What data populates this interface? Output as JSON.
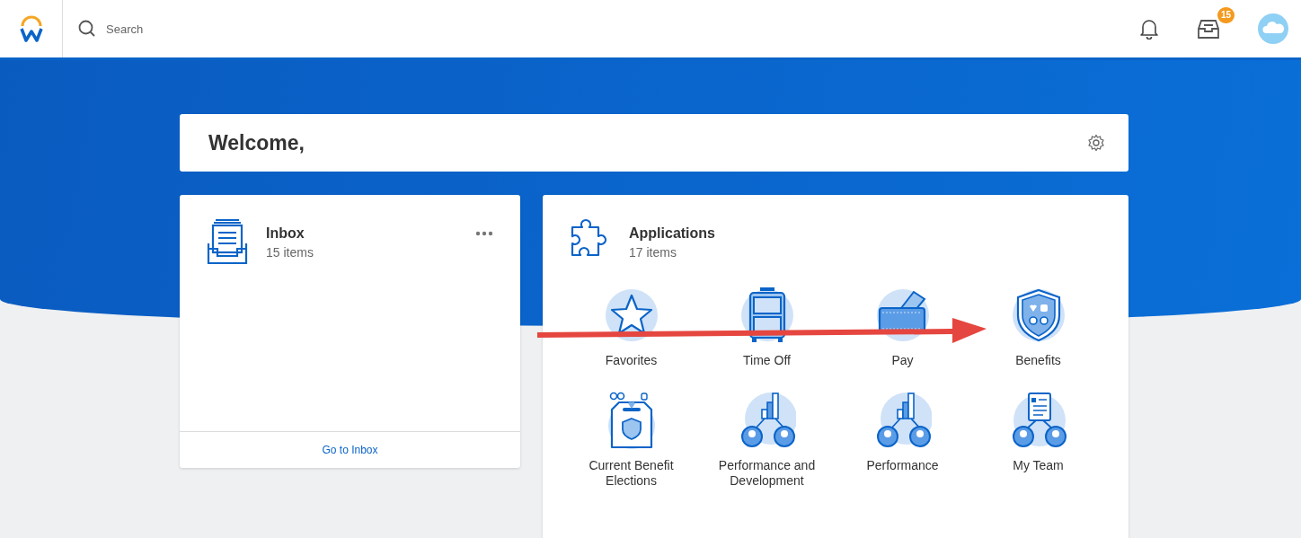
{
  "header": {
    "search": {
      "placeholder": "Search"
    },
    "inbox_badge": "15"
  },
  "welcome": {
    "title": "Welcome,"
  },
  "inbox": {
    "title": "Inbox",
    "count": "15 items",
    "link": "Go to Inbox"
  },
  "applications": {
    "title": "Applications",
    "count": "17 items",
    "apps": [
      {
        "label": "Favorites",
        "kind": "star"
      },
      {
        "label": "Time Off",
        "kind": "suitcase"
      },
      {
        "label": "Pay",
        "kind": "wallet"
      },
      {
        "label": "Benefits",
        "kind": "shield"
      },
      {
        "label": "Current Benefit Elections",
        "kind": "ballot"
      },
      {
        "label": "Performance and Development",
        "kind": "chart-team"
      },
      {
        "label": "Performance",
        "kind": "chart-team"
      },
      {
        "label": "My Team",
        "kind": "doc-team"
      }
    ]
  }
}
